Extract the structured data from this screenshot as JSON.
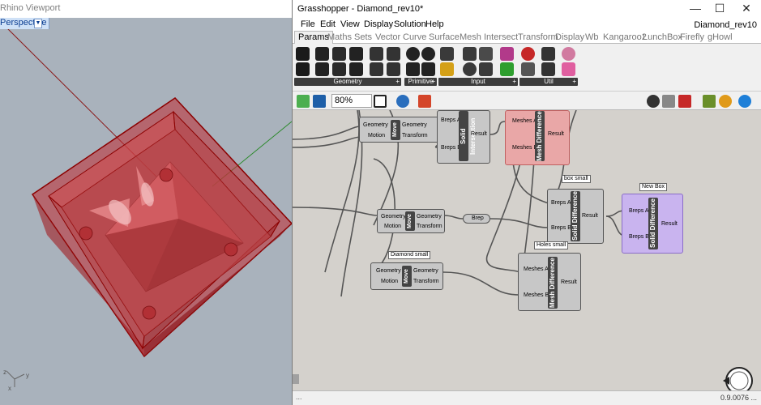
{
  "rhino": {
    "title": "Rhino Viewport",
    "view_label": "Perspective",
    "view_arrow": "▼",
    "axes": {
      "x": "x",
      "y": "y",
      "z": "z"
    }
  },
  "grasshopper": {
    "title": "Grasshopper - Diamond_rev10*",
    "doc_name": "Diamond_rev10",
    "window_buttons": {
      "minimize": "—",
      "maximize": "☐",
      "close": "✕"
    },
    "menu": [
      "File",
      "Edit",
      "View",
      "Display",
      "Solution",
      "Help"
    ],
    "tabs": [
      "Params",
      "Maths",
      "Sets",
      "Vector",
      "Curve",
      "Surface",
      "Mesh",
      "Intersect",
      "Transform",
      "Display",
      "Wb",
      "Kangaroo2",
      "LunchBox",
      "Firefly",
      "gHowl"
    ],
    "active_tab": "Params",
    "ribbon_groups": [
      "Geometry",
      "Primitive",
      "Input",
      "Util"
    ],
    "zoom": "80%",
    "status_left": "...",
    "status_right": "0.9.0076 ..."
  },
  "canvas": {
    "components": [
      {
        "id": "move-top",
        "title": "Move",
        "inputs": [
          "Geometry",
          "Motion"
        ],
        "outputs": [
          "Geometry",
          "Transform"
        ]
      },
      {
        "id": "solid-intersection",
        "title": "Solid Intersection",
        "inputs": [
          "Breps A",
          "Breps B"
        ],
        "outputs": [
          "Result"
        ]
      },
      {
        "id": "mesh-difference-top",
        "title": "Mesh Difference",
        "inputs": [
          "Meshes A",
          "Meshes B"
        ],
        "outputs": [
          "Result"
        ]
      },
      {
        "id": "move-mid",
        "title": "Move",
        "inputs": [
          "Geometry",
          "Motion"
        ],
        "outputs": [
          "Geometry",
          "Transform"
        ]
      },
      {
        "id": "brep-param",
        "title": "Brep"
      },
      {
        "id": "solid-difference-box",
        "title": "Solid Difference",
        "tag": "box small",
        "inputs": [
          "Breps A",
          "Breps B"
        ],
        "outputs": [
          "Result"
        ]
      },
      {
        "id": "solid-difference-new",
        "title": "Solid Difference",
        "tag": "New Box",
        "inputs": [
          "Breps A",
          "Breps B"
        ],
        "outputs": [
          "Result"
        ]
      },
      {
        "id": "move-diamond",
        "title": "Move",
        "tag": "Diamond small",
        "inputs": [
          "Geometry",
          "Motion"
        ],
        "outputs": [
          "Geometry",
          "Transform"
        ]
      },
      {
        "id": "mesh-difference-holes",
        "title": "Mesh Difference",
        "tag": "Holes small",
        "inputs": [
          "Meshes A",
          "Meshes B"
        ],
        "outputs": [
          "Result"
        ]
      }
    ]
  },
  "colors": {
    "rhino_bg": "#a9b2bc",
    "box_red": "#c0282d",
    "canvas_bg": "#d4d1cc",
    "selected_pink": "#e9a7a7",
    "selected_purple": "#c9b4ef"
  }
}
